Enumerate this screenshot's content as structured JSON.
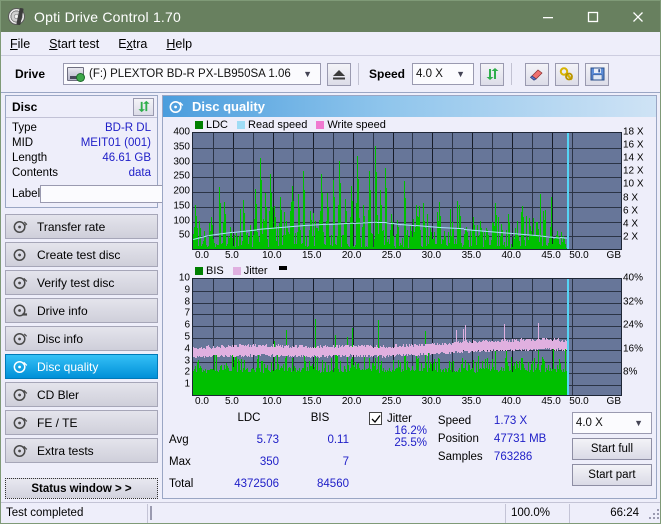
{
  "window": {
    "title": "Opti Drive Control 1.70",
    "titlebar_color": "#68805f",
    "minimize": "minimize-icon",
    "maximize": "maximize-icon",
    "close": "close-icon"
  },
  "menu": {
    "items": [
      {
        "label": "File",
        "accel": "F"
      },
      {
        "label": "Start test",
        "accel": "S"
      },
      {
        "label": "Extra",
        "accel": "x"
      },
      {
        "label": "Help",
        "accel": "H"
      }
    ]
  },
  "toolbar": {
    "drive_label": "Drive",
    "drive_value": "(F:)  PLEXTOR BD-R  PX-LB950SA 1.06",
    "eject_icon": "eject-icon",
    "speed_label": "Speed",
    "speed_value": "4.0 X",
    "refresh_icon": "refresh-icon",
    "erase_icon": "eraser-icon",
    "tools_icon": "wrench-icon",
    "save_icon": "floppy-save-icon"
  },
  "disc": {
    "heading": "Disc",
    "refresh_icon": "refresh-icon",
    "rows": [
      {
        "key": "Type",
        "value": "BD-R DL"
      },
      {
        "key": "MID",
        "value": "MEIT01 (001)"
      },
      {
        "key": "Length",
        "value": "46.61 GB"
      },
      {
        "key": "Contents",
        "value": "data"
      }
    ],
    "label_key": "Label",
    "label_value": "",
    "label_placeholder": "",
    "disc_icon": "disc-icon"
  },
  "nav": {
    "items": [
      {
        "label": "Transfer rate",
        "icon": "disc-test-icon",
        "active": false
      },
      {
        "label": "Create test disc",
        "icon": "disc-burn-icon",
        "active": false
      },
      {
        "label": "Verify test disc",
        "icon": "disc-verify-icon",
        "active": false
      },
      {
        "label": "Drive info",
        "icon": "drive-info-icon",
        "active": false
      },
      {
        "label": "Disc info",
        "icon": "disc-info-icon",
        "active": false
      },
      {
        "label": "Disc quality",
        "icon": "disc-quality-icon",
        "active": true
      },
      {
        "label": "CD Bler",
        "icon": "disc-bler-icon",
        "active": false
      },
      {
        "label": "FE / TE",
        "icon": "disc-fete-icon",
        "active": false
      },
      {
        "label": "Extra tests",
        "icon": "disc-extra-icon",
        "active": false
      }
    ],
    "status_window": "Status window > >"
  },
  "main": {
    "heading": "Disc quality",
    "heading_icon": "disc-quality-icon"
  },
  "chart_data": [
    {
      "type": "line",
      "id": "ldc-chart",
      "title": "",
      "legend": [
        {
          "label": "LDC",
          "color": "#008000"
        },
        {
          "label": "Read speed",
          "color": "#9fdcf5"
        },
        {
          "label": "Write speed",
          "color": "#f07ad0"
        }
      ],
      "legend_position": "top",
      "grid": true,
      "xlabel": "GB",
      "x_ticks": [
        "0.0",
        "5.0",
        "10.0",
        "15.0",
        "20.0",
        "25.0",
        "30.0",
        "35.0",
        "40.0",
        "45.0",
        "50.0"
      ],
      "xlim": [
        0,
        50
      ],
      "ylabel_left": "LDC",
      "y_ticks_left": [
        "400",
        "350",
        "300",
        "250",
        "200",
        "150",
        "100",
        "50"
      ],
      "ylim_left": [
        0,
        400
      ],
      "ylabel_right": "Speed",
      "y_ticks_right": [
        "18 X",
        "16 X",
        "14 X",
        "12 X",
        "10 X",
        "8 X",
        "6 X",
        "4 X",
        "2 X"
      ],
      "ylim_right": [
        0,
        18
      ],
      "series": [
        {
          "name": "Read speed",
          "color": "#9fdcf5",
          "x": [
            0,
            2,
            5,
            8,
            11,
            14,
            17,
            20,
            23,
            24,
            25,
            26,
            28,
            31,
            34,
            37,
            40,
            43,
            46,
            46.9
          ],
          "y": [
            1.8,
            2.4,
            2.9,
            3.3,
            3.6,
            3.9,
            4.1,
            4.3,
            4.5,
            4.5,
            4.3,
            4.1,
            3.9,
            3.6,
            3.4,
            3.1,
            2.8,
            2.5,
            2.1,
            2.0
          ]
        },
        {
          "name": "LDC",
          "color": "#00c000",
          "note": "Per-sample error counts, baseline approx 5-20 with frequent spikes up to 350",
          "baseline_avg": 5.73,
          "max": 350,
          "spikes": [
            {
              "x": 0.3,
              "y": 150
            },
            {
              "x": 0.8,
              "y": 95
            },
            {
              "x": 1.4,
              "y": 60
            },
            {
              "x": 2.2,
              "y": 110
            },
            {
              "x": 3.3,
              "y": 210
            },
            {
              "x": 3.9,
              "y": 160
            },
            {
              "x": 4.6,
              "y": 75
            },
            {
              "x": 5.4,
              "y": 55
            },
            {
              "x": 6.3,
              "y": 165
            },
            {
              "x": 7.1,
              "y": 80
            },
            {
              "x": 7.8,
              "y": 205
            },
            {
              "x": 8.4,
              "y": 310
            },
            {
              "x": 9.0,
              "y": 190
            },
            {
              "x": 9.6,
              "y": 255
            },
            {
              "x": 10.2,
              "y": 145
            },
            {
              "x": 10.9,
              "y": 175
            },
            {
              "x": 11.7,
              "y": 95
            },
            {
              "x": 12.4,
              "y": 215
            },
            {
              "x": 13.1,
              "y": 185
            },
            {
              "x": 13.8,
              "y": 265
            },
            {
              "x": 14.6,
              "y": 130
            },
            {
              "x": 15.3,
              "y": 95
            },
            {
              "x": 16.1,
              "y": 255
            },
            {
              "x": 16.8,
              "y": 190
            },
            {
              "x": 17.6,
              "y": 235
            },
            {
              "x": 18.3,
              "y": 300
            },
            {
              "x": 19.0,
              "y": 170
            },
            {
              "x": 19.8,
              "y": 215
            },
            {
              "x": 20.5,
              "y": 315
            },
            {
              "x": 21.3,
              "y": 150
            },
            {
              "x": 22.1,
              "y": 265
            },
            {
              "x": 22.8,
              "y": 350
            },
            {
              "x": 23.4,
              "y": 200
            },
            {
              "x": 24.1,
              "y": 275
            },
            {
              "x": 24.8,
              "y": 120
            },
            {
              "x": 25.6,
              "y": 100
            },
            {
              "x": 26.4,
              "y": 230
            },
            {
              "x": 27.2,
              "y": 80
            },
            {
              "x": 28.0,
              "y": 150
            },
            {
              "x": 28.9,
              "y": 95
            },
            {
              "x": 29.7,
              "y": 70
            },
            {
              "x": 30.6,
              "y": 125
            },
            {
              "x": 31.5,
              "y": 60
            },
            {
              "x": 32.4,
              "y": 90
            },
            {
              "x": 33.3,
              "y": 140
            },
            {
              "x": 34.2,
              "y": 75
            },
            {
              "x": 35.1,
              "y": 110
            },
            {
              "x": 36.0,
              "y": 95
            },
            {
              "x": 36.9,
              "y": 65
            },
            {
              "x": 37.8,
              "y": 155
            },
            {
              "x": 38.6,
              "y": 85
            },
            {
              "x": 39.5,
              "y": 120
            },
            {
              "x": 40.4,
              "y": 70
            },
            {
              "x": 41.2,
              "y": 145
            },
            {
              "x": 42.1,
              "y": 105
            },
            {
              "x": 43.0,
              "y": 90
            },
            {
              "x": 43.9,
              "y": 130
            },
            {
              "x": 44.7,
              "y": 75
            },
            {
              "x": 45.6,
              "y": 60
            },
            {
              "x": 46.4,
              "y": 45
            }
          ]
        }
      ],
      "cursor_x": 46.9
    },
    {
      "type": "line",
      "id": "bis-jitter-chart",
      "title": "",
      "legend": [
        {
          "label": "BIS",
          "color": "#008000"
        },
        {
          "label": "Jitter",
          "color": "#e0b0e0"
        }
      ],
      "legend_position": "top",
      "grid": true,
      "xlabel": "GB",
      "x_ticks": [
        "0.0",
        "5.0",
        "10.0",
        "15.0",
        "20.0",
        "25.0",
        "30.0",
        "35.0",
        "40.0",
        "45.0",
        "50.0"
      ],
      "xlim": [
        0,
        50
      ],
      "ylabel_left": "BIS",
      "y_ticks_left": [
        "10",
        "9",
        "8",
        "7",
        "6",
        "5",
        "4",
        "3",
        "2",
        "1"
      ],
      "ylim_left": [
        0,
        10
      ],
      "ylabel_right": "Jitter",
      "y_ticks_right": [
        "40%",
        "32%",
        "24%",
        "16%",
        "8%"
      ],
      "ylim_right": [
        0,
        40
      ],
      "series": [
        {
          "name": "Jitter",
          "color": "#e0b0e0",
          "note": "Band averaging ~15-17%, rising to 24% spikes after 32 GB",
          "avg": 16.2,
          "max": 25.5,
          "x": [
            0,
            3,
            6,
            9,
            12,
            15,
            18,
            21,
            24,
            27,
            30,
            33,
            36,
            39,
            42,
            45,
            46.9
          ],
          "y": [
            15.0,
            15.4,
            15.6,
            15.8,
            15.4,
            15.3,
            15.5,
            15.6,
            15.4,
            15.8,
            16.2,
            16.8,
            17.2,
            17.4,
            17.6,
            17.8,
            17.4
          ]
        },
        {
          "name": "BIS",
          "color": "#00c000",
          "note": "Dense fill to approx 2.2 with frequent spikes to 5-7",
          "avg": 0.11,
          "max": 7,
          "baseline": 2.2
        }
      ],
      "cursor_x": 46.9
    }
  ],
  "stats": {
    "columns": [
      "LDC",
      "BIS"
    ],
    "rows": [
      {
        "label": "Avg",
        "ldc": "5.73",
        "bis": "0.11"
      },
      {
        "label": "Max",
        "ldc": "350",
        "bis": "7"
      },
      {
        "label": "Total",
        "ldc": "4372506",
        "bis": "84560"
      }
    ],
    "jitter": {
      "checkbox_label": "Jitter",
      "checked": true,
      "avg": "16.2%",
      "max": "25.5%"
    },
    "speed_label": "Speed",
    "speed_value": "1.73 X",
    "position_label": "Position",
    "position_value": "47731 MB",
    "samples_label": "Samples",
    "samples_value": "763286",
    "speed_select": "4.0 X",
    "start_full": "Start full",
    "start_part": "Start part"
  },
  "statusbar": {
    "message": "Test completed",
    "progress_percent": 100,
    "progress_text": "100.0%",
    "elapsed": "66:24",
    "progress_color": "#00a81a"
  }
}
